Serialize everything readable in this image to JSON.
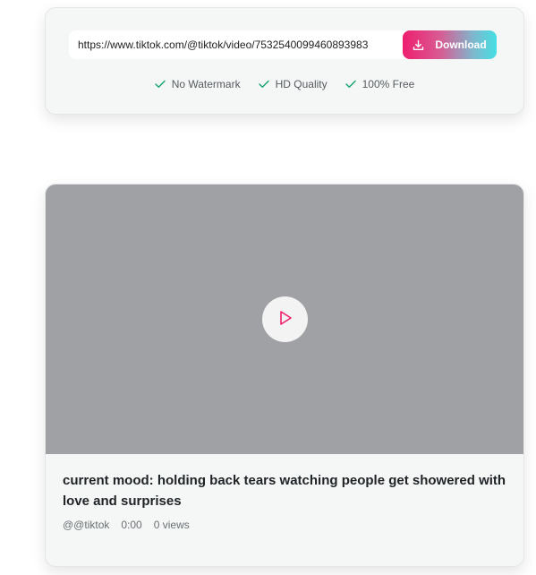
{
  "downloader": {
    "url_value": "https://www.tiktok.com/@tiktok/video/7532540099460893983",
    "download_label": "Download",
    "features": [
      {
        "label": "No Watermark",
        "icon": "check-icon"
      },
      {
        "label": "HD Quality",
        "icon": "check-icon"
      },
      {
        "label": "100% Free",
        "icon": "check-icon"
      }
    ]
  },
  "video": {
    "title": "current mood: holding back tears watching people get showered with love and surprises",
    "author": "@@tiktok",
    "duration": "0:00",
    "views": "0 views"
  },
  "colors": {
    "accent_pink": "#ee1f6e",
    "accent_cyan": "#45dfe4",
    "check_green": "#14a36b",
    "video_placeholder": "#a0a1a4"
  },
  "icons": {
    "download": "download-icon",
    "play": "play-icon",
    "check": "check-icon"
  }
}
